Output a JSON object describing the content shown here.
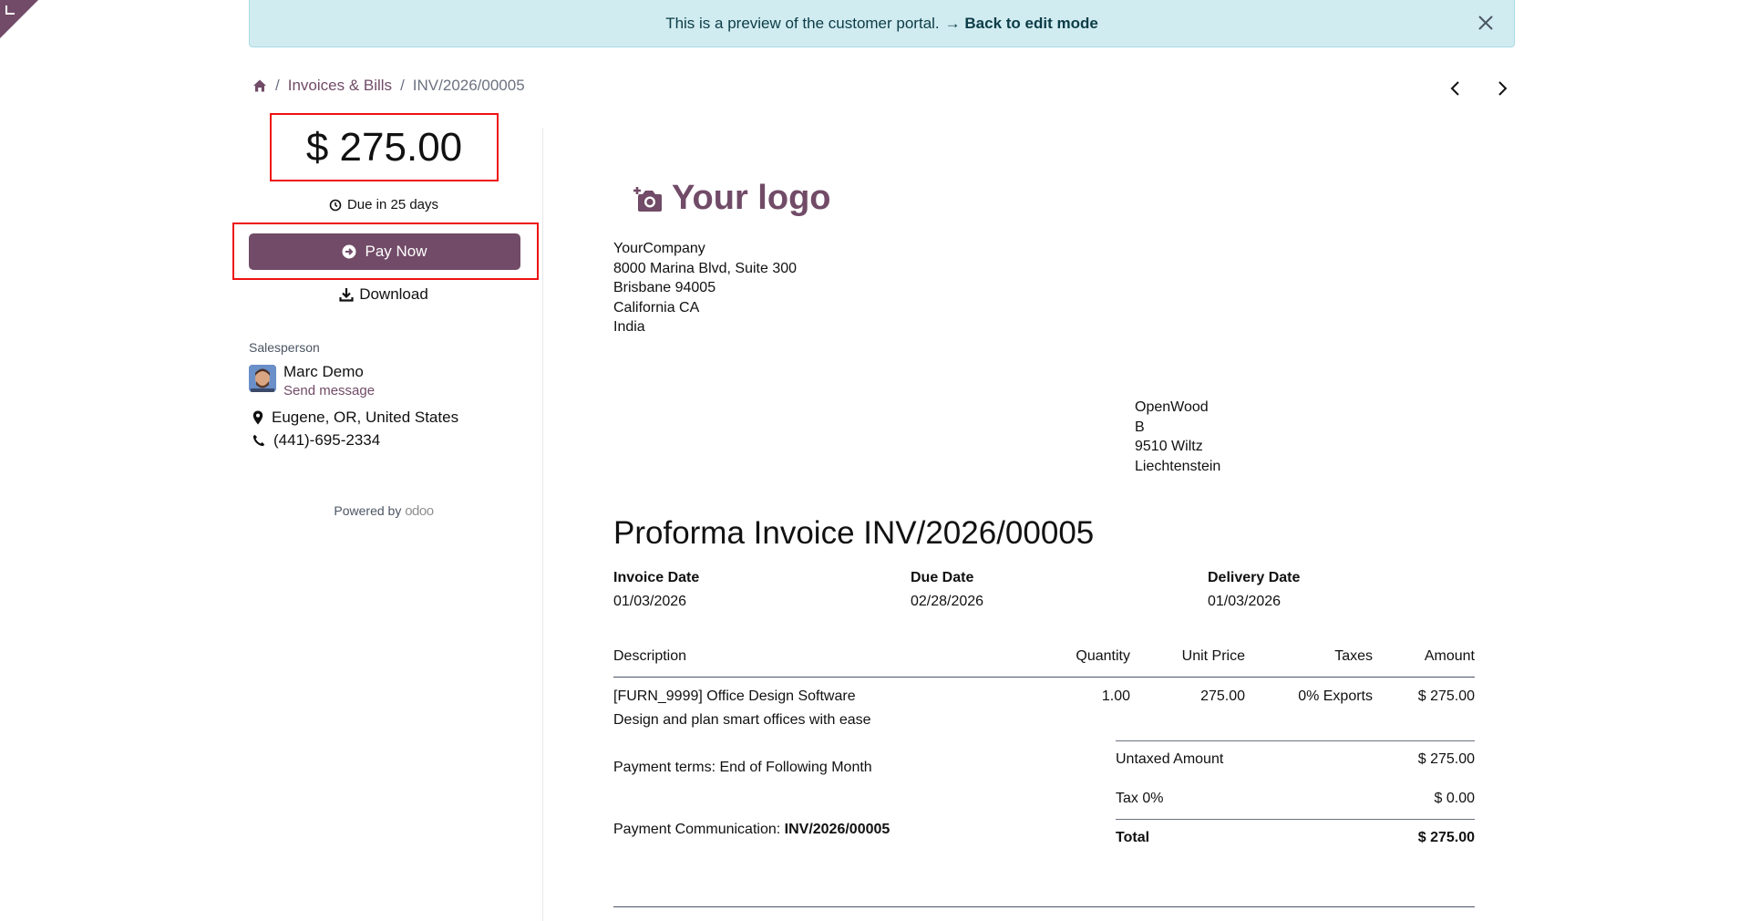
{
  "banner": {
    "message": "This is a preview of the customer portal.",
    "link": "→ Back to edit mode"
  },
  "breadcrumb": {
    "section": "Invoices & Bills",
    "current": "INV/2026/00005"
  },
  "sidebar": {
    "amount": "$ 275.00",
    "due": "Due in 25 days",
    "pay_label": "Pay Now",
    "download_label": "Download",
    "salesperson_label": "Salesperson",
    "salesperson_name": "Marc Demo",
    "send_message": "Send message",
    "location": "Eugene, OR, United States",
    "phone": "(441)-695-2334",
    "powered_by": "Powered by",
    "powered_brand": "odoo"
  },
  "document": {
    "logo_text": "Your logo",
    "company": [
      "YourCompany",
      "8000 Marina Blvd, Suite 300",
      "Brisbane 94005",
      "California CA",
      "India"
    ],
    "customer": [
      "OpenWood",
      "B",
      "9510 Wiltz",
      "Liechtenstein"
    ],
    "title": "Proforma Invoice INV/2026/00005",
    "invoice_date_label": "Invoice Date",
    "invoice_date": "01/03/2026",
    "due_date_label": "Due Date",
    "due_date": "02/28/2026",
    "delivery_date_label": "Delivery Date",
    "delivery_date": "01/03/2026",
    "columns": {
      "description": "Description",
      "quantity": "Quantity",
      "unit_price": "Unit Price",
      "taxes": "Taxes",
      "amount": "Amount"
    },
    "line": {
      "description": "[FURN_9999] Office Design Software",
      "description_2": "Design and plan smart offices with ease",
      "quantity": "1.00",
      "unit_price": "275.00",
      "taxes": "0% Exports",
      "amount": "$ 275.00"
    },
    "payment_terms": "Payment terms: End of Following Month",
    "payment_comm_label": "Payment Communication:",
    "payment_comm_value": "INV/2026/00005",
    "untaxed_label": "Untaxed Amount",
    "untaxed_value": "$ 275.00",
    "tax_label": "Tax 0%",
    "tax_value": "$ 0.00",
    "total_label": "Total",
    "total_value": "$ 275.00"
  },
  "colors": {
    "brand": "#714B67",
    "banner_bg": "#d1ecf1",
    "highlight": "#ee1111"
  }
}
